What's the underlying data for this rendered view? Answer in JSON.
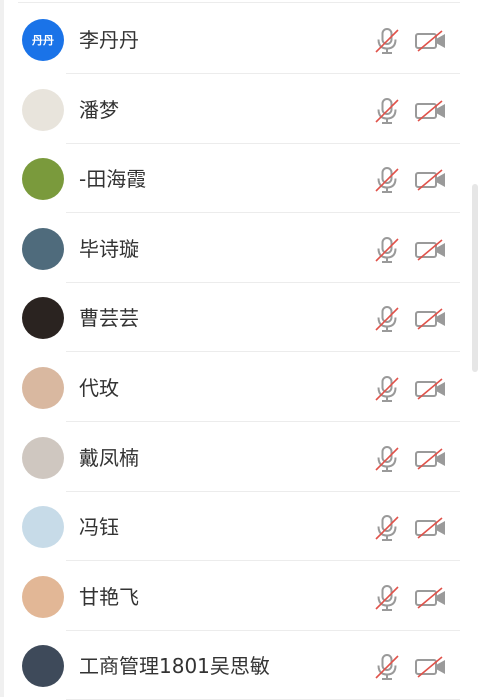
{
  "participants": [
    {
      "name": "李丹丹",
      "avatar": {
        "kind": "initials",
        "text": "丹丹",
        "color": "#1a73e8"
      },
      "mic": "muted",
      "camera": "off"
    },
    {
      "name": "潘梦",
      "avatar": {
        "kind": "photo",
        "color": "#e8e4dc"
      },
      "mic": "muted",
      "camera": "off"
    },
    {
      "name": "-田海霞",
      "avatar": {
        "kind": "photo",
        "color": "#7a9a3c"
      },
      "mic": "muted",
      "camera": "off"
    },
    {
      "name": "毕诗璇",
      "avatar": {
        "kind": "photo",
        "color": "#4f6b7c"
      },
      "mic": "muted",
      "camera": "off"
    },
    {
      "name": "曹芸芸",
      "avatar": {
        "kind": "photo",
        "color": "#2a2320"
      },
      "mic": "muted",
      "camera": "off"
    },
    {
      "name": "代玫",
      "avatar": {
        "kind": "photo",
        "color": "#d9b8a0"
      },
      "mic": "muted",
      "camera": "off"
    },
    {
      "name": "戴凤楠",
      "avatar": {
        "kind": "photo",
        "color": "#cfc7c0"
      },
      "mic": "muted",
      "camera": "off"
    },
    {
      "name": "冯钰",
      "avatar": {
        "kind": "photo",
        "color": "#c7dbe8"
      },
      "mic": "muted",
      "camera": "off"
    },
    {
      "name": "甘艳飞",
      "avatar": {
        "kind": "photo",
        "color": "#e2b796"
      },
      "mic": "muted",
      "camera": "off"
    },
    {
      "name": "工商管理1801吴思敏",
      "avatar": {
        "kind": "photo",
        "color": "#3e4a5a"
      },
      "mic": "muted",
      "camera": "off"
    }
  ],
  "colors": {
    "icon": "#9a9a9a",
    "strike": "#e0524a",
    "name_text": "#333333",
    "divider": "#ececec"
  },
  "icons": {
    "mic": "microphone-muted-icon",
    "camera": "camera-off-icon"
  }
}
